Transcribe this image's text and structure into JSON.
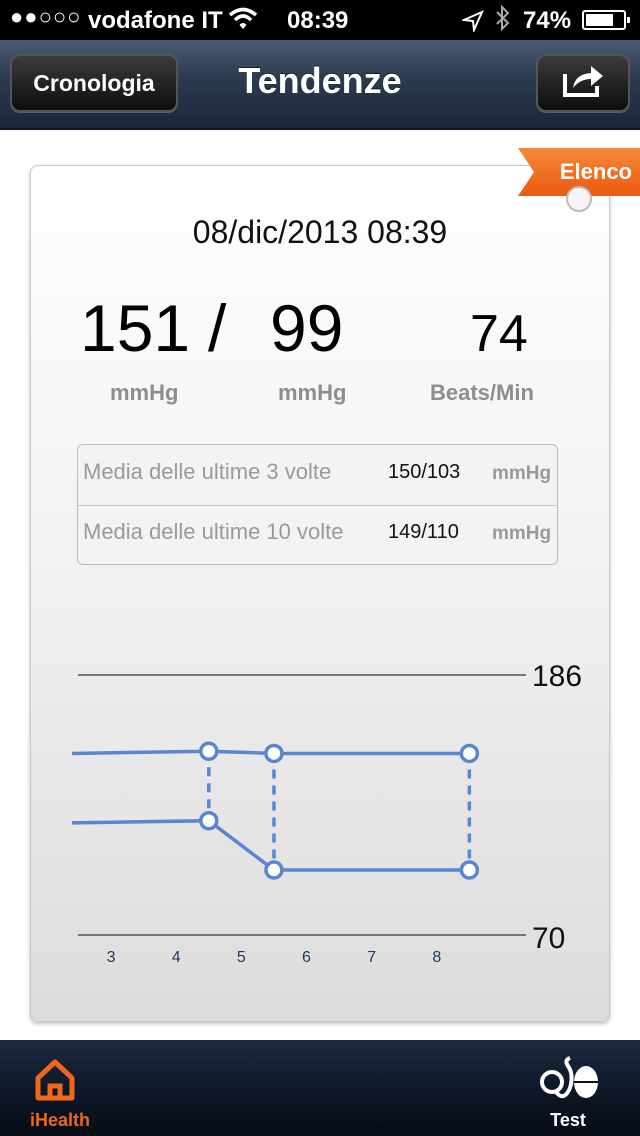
{
  "status_bar": {
    "signal": "●●○○○",
    "carrier": "vodafone IT",
    "time": "08:39",
    "battery": "74%",
    "battery_level": 0.74,
    "icons": [
      "wifi-icon",
      "location-arrow-icon",
      "bluetooth-icon",
      "battery-icon"
    ]
  },
  "nav": {
    "back_label": "Cronologia",
    "title": "Tendenze",
    "share_icon": "share-icon"
  },
  "reading": {
    "flag_label": "Elenco",
    "datetime": "08/dic/2013 08:39",
    "systolic": "151",
    "slash": "/",
    "diastolic": "99",
    "pulse": "74",
    "unit_systolic": "mmHg",
    "unit_diastolic": "mmHg",
    "unit_pulse": "Beats/Min"
  },
  "averages": [
    {
      "label": "Media delle ultime 3 volte",
      "value": "150/103",
      "unit": "mmHg"
    },
    {
      "label": "Media delle ultime 10 volte",
      "value": "149/110",
      "unit": "mmHg"
    }
  ],
  "chart_data": {
    "type": "line",
    "y_max_label": "186",
    "y_min_label": "70",
    "ylim": [
      70,
      186
    ],
    "xlim": [
      2.4,
      9.4
    ],
    "x_ticks": [
      "3",
      "4",
      "5",
      "6",
      "7",
      "8"
    ],
    "x_tick_values": [
      3,
      4,
      5,
      6,
      7,
      8
    ],
    "color": "#5b85d0",
    "series": [
      {
        "x": [
          2.4,
          4.5,
          5.5,
          8.5
        ],
        "values": [
          151,
          152,
          151,
          151
        ],
        "markers_from": 1
      },
      {
        "x": [
          2.4,
          4.5,
          5.5,
          8.5
        ],
        "values": [
          120,
          121,
          99,
          99
        ],
        "markers_from": 1
      }
    ],
    "dashed_connectors_at_x": [
      4.5,
      5.5,
      8.5
    ]
  },
  "tabs": [
    {
      "label": "iHealth",
      "icon": "home-icon",
      "active": true
    },
    {
      "label": "Test",
      "icon": "blood-pressure-monitor-icon",
      "active": false
    }
  ]
}
